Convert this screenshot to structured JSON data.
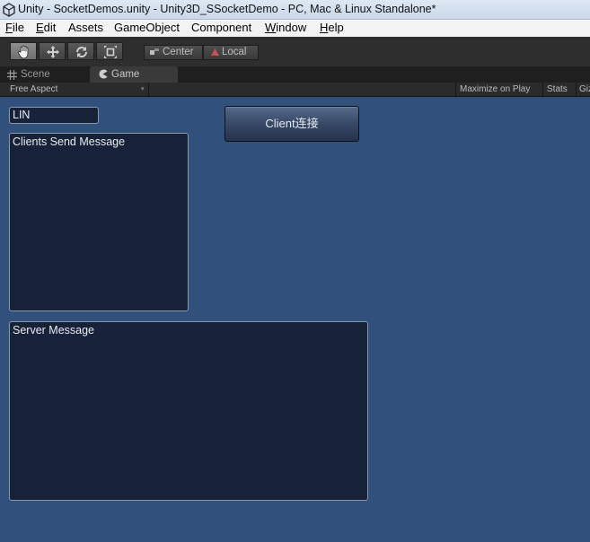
{
  "window": {
    "title": "Unity - SocketDemos.unity - Unity3D_SSocketDemo - PC, Mac & Linux Standalone*"
  },
  "menu": {
    "items": [
      {
        "label": "File",
        "accel": "F"
      },
      {
        "label": "Edit",
        "accel": "E"
      },
      {
        "label": "Assets",
        "accel": ""
      },
      {
        "label": "GameObject",
        "accel": ""
      },
      {
        "label": "Component",
        "accel": ""
      },
      {
        "label": "Window",
        "accel": "W"
      },
      {
        "label": "Help",
        "accel": "H"
      }
    ]
  },
  "toolbar": {
    "tools": [
      "hand-tool",
      "move-tool",
      "rotate-tool",
      "scale-tool"
    ],
    "active_tool": "hand-tool",
    "pivot_label": "Center",
    "space_label": "Local"
  },
  "tabs": {
    "scene": "Scene",
    "game": "Game"
  },
  "gamebar": {
    "aspect": "Free Aspect",
    "maximize": "Maximize on Play",
    "stats": "Stats",
    "gizmos": "Gizmos"
  },
  "game": {
    "name_field_value": "LIN",
    "client_box_text": "Clients Send Message",
    "server_box_text": "Server Message",
    "connect_button_label": "Client连接"
  },
  "colors": {
    "viewport_bg": "#32507c",
    "gui_box_bg": "#172239",
    "toolbar_bg": "#2e2e2e"
  }
}
